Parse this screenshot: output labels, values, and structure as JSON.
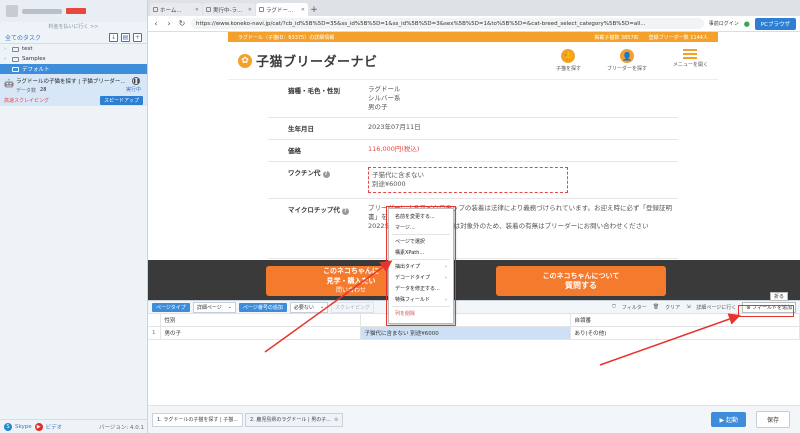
{
  "sidebar": {
    "subtitle": "料金を払いに行く >>",
    "tasks_title": "全てのタスク",
    "folders": [
      "test",
      "Samples"
    ],
    "default_folder": "デフォルト",
    "task": {
      "name": "ラグドールの子猫を探す | 子猫ブリーダー...",
      "records_label": "データ数",
      "records": "28",
      "status": "実行中",
      "mode": "高速スクレイピング",
      "speed_button": "スピードアップ"
    },
    "footer": {
      "skype": "Skype",
      "video": "ビデオ",
      "version": "バージョン: 4.0.1"
    }
  },
  "browser": {
    "tabs": [
      "ホーム...",
      "実行中-ラ...",
      "ラグドー..."
    ],
    "url": "https://www.koneko-navi.jp/cat/?cb_id%5B%5D=35&ss_id%5B%5D=1&ss_id%5B%5D=3&sex%5B%5D=1&to%5B%5D=&cat-breed_select_category%5B%5D=all...",
    "login": "事前ログイン",
    "pc_browser": "PCブラウザ"
  },
  "page": {
    "promo_left": "ラグドール（子猫ID：63375）の詳細情報",
    "promo_mid": "掲載子猫数 3857匹",
    "promo_right": "登録ブリーダー数 1144人",
    "logo": "子猫ブリーダーナビ",
    "nav": [
      "子猫を探す",
      "ブリーダーを探す",
      "メニューを開く"
    ],
    "rows": [
      {
        "label": "猫種・毛色・性別",
        "value": "ラグドール\nシルバー系\n男の子"
      },
      {
        "label": "生年月日",
        "value": "2023年07月11日"
      },
      {
        "label": "価格",
        "value": "116,000円(税込)"
      },
      {
        "label": "ワクチン代",
        "value": "子猫代に含まない\n別途¥6000"
      },
      {
        "label": "マイクロチップ代",
        "value": "ブリーダーによるマイクロチップの装着は法律により義務づけられています。お迎え時に必ず「登録証明書」を受け取ってください。\n2022年5月以前に生まれた猫は対象外のため、装着の有無はブリーダーにお問い合わせください"
      }
    ],
    "cta_left_1": "このネコちゃんに",
    "cta_left_2": "見学・購入",
    "cta_left_3": "たい",
    "cta_left_sub": "問い合わせ",
    "cta_right_1": "このネコちゃんについて",
    "cta_right_2": "質問する"
  },
  "context_menu": {
    "items": [
      "名前を変更する...",
      "マージ...",
      "ページで選択",
      "構素XPath...",
      "抽出タイプ",
      "デコードタイプ",
      "データを修正する...",
      "特殊フィールド",
      "列を削除"
    ]
  },
  "panel": {
    "page_type_tag": "ページタイプ",
    "page_type": "詳細ページ",
    "page_num_tag": "ページ番号の追加",
    "page_num": "必要ない",
    "scraping_label": "スクレイピング",
    "filter": "フィルター",
    "clear": "クリア",
    "detail_page": "詳細ページに行く",
    "add_field": "フィールドを追加",
    "collapse": "折る",
    "columns": [
      "性別",
      "",
      "自領番"
    ],
    "row": [
      "男の子",
      "子猫代に含まない 別途¥6000",
      "あり(その他)"
    ]
  },
  "bottom": {
    "tabs": [
      "1. ラグドールの子猫を探す | 子猫...",
      "2. 鹿児島県のラグドール | 男の子..."
    ],
    "run": "起動",
    "save": "保存"
  },
  "colors": {
    "accent": "#3e8ddb",
    "orange": "#f3a12a",
    "cta": "#f47a2d",
    "annotation": "#e5352e"
  }
}
